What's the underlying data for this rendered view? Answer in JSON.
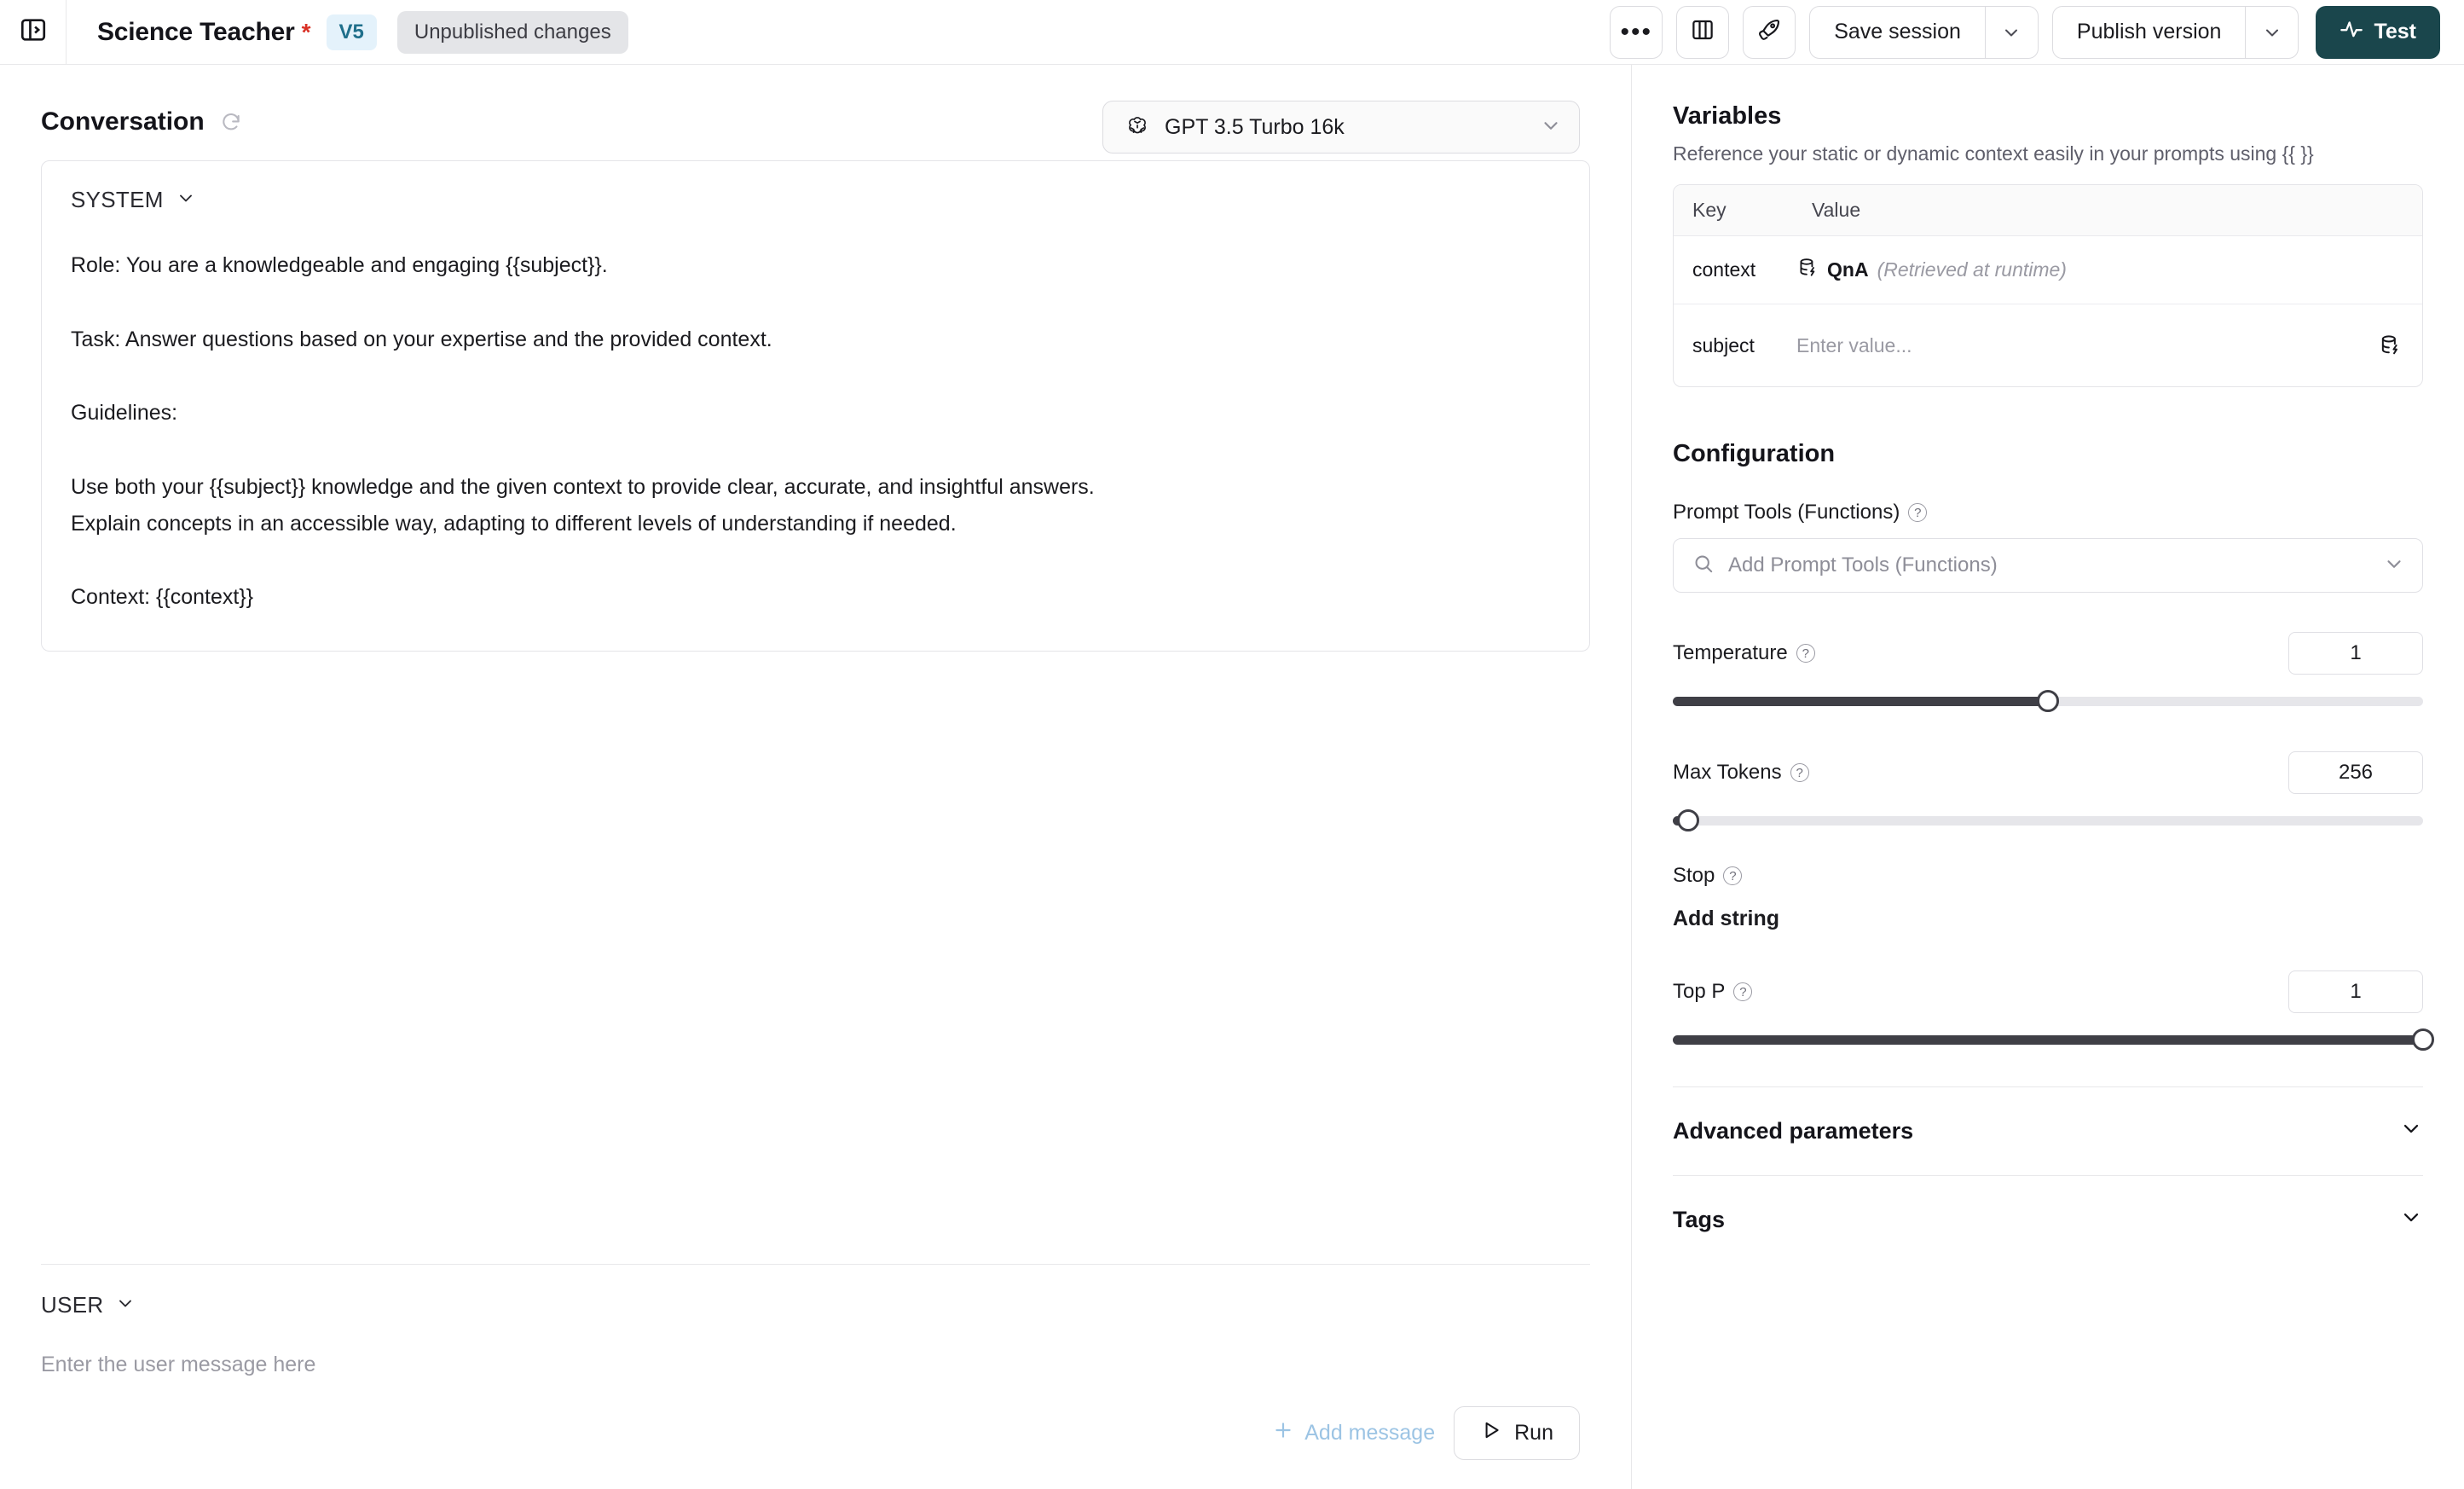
{
  "topbar": {
    "project_title": "Science Teacher",
    "dirty_marker": "*",
    "version_badge": "V5",
    "unpublished_badge": "Unpublished changes",
    "more_label": "•••",
    "save_session_label": "Save session",
    "publish_version_label": "Publish version",
    "test_label": "Test"
  },
  "conversation": {
    "heading": "Conversation",
    "model": "GPT 3.5 Turbo 16k",
    "system_role_label": "SYSTEM",
    "system_prompt": "Role: You are a knowledgeable and engaging {{subject}}.\n\nTask: Answer questions based on your expertise and the provided context.\n\nGuidelines:\n\nUse both your {{subject}} knowledge and the given context to provide clear, accurate, and insightful answers.\nExplain concepts in an accessible way, adapting to different levels of understanding if needed.\n\nContext: {{context}}",
    "user_role_label": "USER",
    "user_placeholder": "Enter the user message here",
    "add_message_label": "Add message",
    "run_label": "Run"
  },
  "variables": {
    "title": "Variables",
    "subtitle": "Reference your static or dynamic context easily in your prompts using {{ }}",
    "columns": [
      "Key",
      "Value"
    ],
    "rows": [
      {
        "key": "context",
        "value": "QnA",
        "hint": "(Retrieved at runtime)"
      },
      {
        "key": "subject",
        "placeholder": "Enter value..."
      }
    ]
  },
  "configuration": {
    "title": "Configuration",
    "prompt_tools_label": "Prompt Tools (Functions)",
    "prompt_tools_placeholder": "Add Prompt Tools (Functions)",
    "temperature_label": "Temperature",
    "temperature_value": "1",
    "temperature_percent": 50,
    "max_tokens_label": "Max Tokens",
    "max_tokens_value": "256",
    "max_tokens_percent": 2,
    "stop_label": "Stop",
    "add_string_label": "Add string",
    "top_p_label": "Top P",
    "top_p_value": "1",
    "top_p_percent": 100,
    "advanced_label": "Advanced parameters",
    "tags_label": "Tags"
  },
  "colors": {
    "accent_test": "#1a464c",
    "version_badge_bg": "#e4f2fb",
    "version_badge_text": "#1f6f8b",
    "dirty_marker": "#d93025",
    "slider_fill": "#3f3f46",
    "add_message": "#9cc4e4"
  }
}
